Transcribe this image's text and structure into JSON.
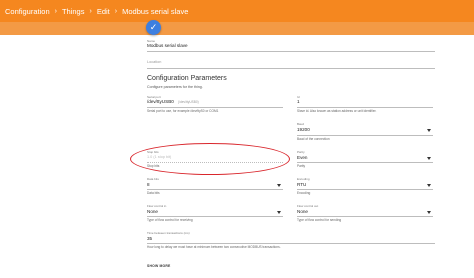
{
  "breadcrumb": [
    "Configuration",
    "Things",
    "Edit",
    "Modbus serial slave"
  ],
  "fab_icon": "check-icon",
  "thing": {
    "name_label": "Name",
    "name_value": "Modbus serial slave",
    "location_placeholder": "Location"
  },
  "config": {
    "title": "Configuration Parameters",
    "subtitle": "Configure parameters for the thing.",
    "fields": {
      "serial_port": {
        "label": "Serial port",
        "value": "/dev/ttyUSB0",
        "hint": "(/dev/ttyUSB0)",
        "desc": "Serial port to use, for example /dev/ttyS0 or COM1"
      },
      "id": {
        "label": "Id",
        "value": "1",
        "desc": "Slave id. Also known as station address or unit identifier."
      },
      "baud": {
        "label": "Baud",
        "value": "19200",
        "desc": "Baud of the connection"
      },
      "stop_bits": {
        "label": "Stop bits",
        "value": "1.0 (1 stop bit)",
        "desc": "Stop bits"
      },
      "parity": {
        "label": "Parity",
        "value": "Even",
        "desc": "Parity"
      },
      "data_bits": {
        "label": "Data bits",
        "value": "8",
        "desc": "Data bits"
      },
      "encoding": {
        "label": "Encoding",
        "value": "RTU",
        "desc": "Encoding"
      },
      "flow_control_in": {
        "label": "Flow control in",
        "value": "None",
        "desc": "Type of flow control for receiving"
      },
      "flow_control_out": {
        "label": "Flow control out",
        "value": "None",
        "desc": "Type of flow control for sending"
      },
      "time_between_transactions": {
        "label": "Time between transactions (ms)",
        "value": "35",
        "desc": "How long to delay we must have at minimum between two consecutive MODBUS transactions."
      }
    },
    "show_more": "SHOW MORE"
  },
  "colors": {
    "appbar": "#f5871f",
    "fab": "#3d7fe0",
    "highlight_ring": "#d9262c"
  }
}
